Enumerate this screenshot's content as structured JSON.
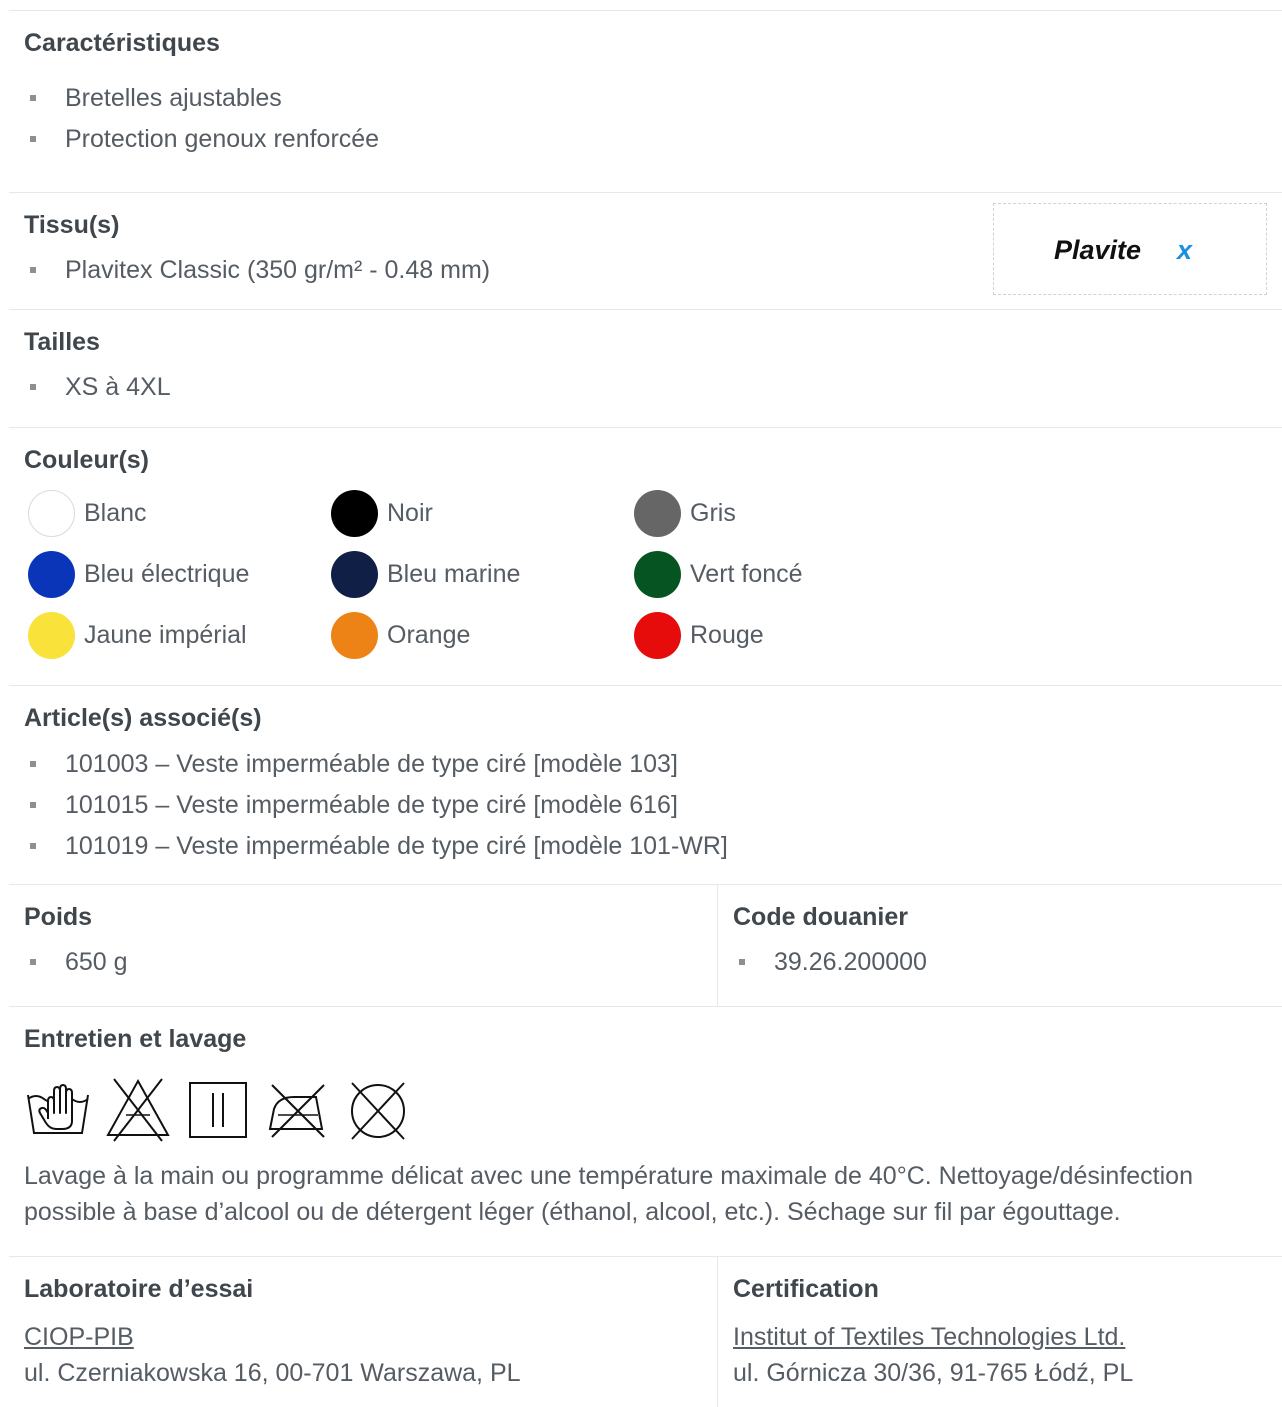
{
  "caracteristiques": {
    "heading": "Caractéristiques",
    "items": [
      "Bretelles ajustables",
      "Protection genoux renforcée"
    ]
  },
  "tissus": {
    "heading": "Tissu(s)",
    "items": [
      "Plavitex Classic (350 gr/m² - 0.48 mm)"
    ],
    "logo": {
      "text_main": "Plavite",
      "text_accent": "x",
      "accent_color": "#1a8fe0",
      "main_color": "#111111"
    }
  },
  "tailles": {
    "heading": "Tailles",
    "items": [
      "XS à 4XL"
    ]
  },
  "couleurs": {
    "heading": "Couleur(s)",
    "items": [
      {
        "label": "Blanc",
        "color": "#ffffff"
      },
      {
        "label": "Noir",
        "color": "#000000"
      },
      {
        "label": "Gris",
        "color": "#666666"
      },
      {
        "label": "Bleu électrique",
        "color": "#0a35b8"
      },
      {
        "label": "Bleu marine",
        "color": "#0f1f46"
      },
      {
        "label": "Vert foncé",
        "color": "#065421"
      },
      {
        "label": "Jaune impérial",
        "color": "#f9e33a"
      },
      {
        "label": "Orange",
        "color": "#ed8316"
      },
      {
        "label": "Rouge",
        "color": "#e60c0c"
      }
    ]
  },
  "articles": {
    "heading": "Article(s) associé(s)",
    "items": [
      "101003 – Veste imperméable de type ciré [modèle 103]",
      "101015 – Veste imperméable de type ciré [modèle 616]",
      "101019 – Veste imperméable de type ciré [modèle 101-WR]"
    ]
  },
  "poids": {
    "heading": "Poids",
    "items": [
      "650 g"
    ]
  },
  "douanier": {
    "heading": "Code douanier",
    "items": [
      "39.26.200000"
    ]
  },
  "entretien": {
    "heading": "Entretien et lavage",
    "icons": [
      "hand-wash-icon",
      "do-not-bleach-icon",
      "line-dry-icon",
      "do-not-iron-icon",
      "do-not-dry-clean-icon"
    ],
    "text": "Lavage à la main ou programme délicat avec une température maximale de 40°C. Nettoyage/désinfection possible à base d’alcool ou de détergent léger (éthanol, alcool, etc.). Séchage sur fil par égouttage."
  },
  "laboratoire": {
    "heading": "Laboratoire d’essai",
    "link": "CIOP-PIB",
    "address": "ul. Czerniakowska 16, 00-701 Warszawa, PL"
  },
  "certification": {
    "heading": "Certification",
    "link": "Institut of Textiles Technologies Ltd.",
    "address": "ul. Górnicza 30/36, 91-765 Łódź, PL"
  }
}
